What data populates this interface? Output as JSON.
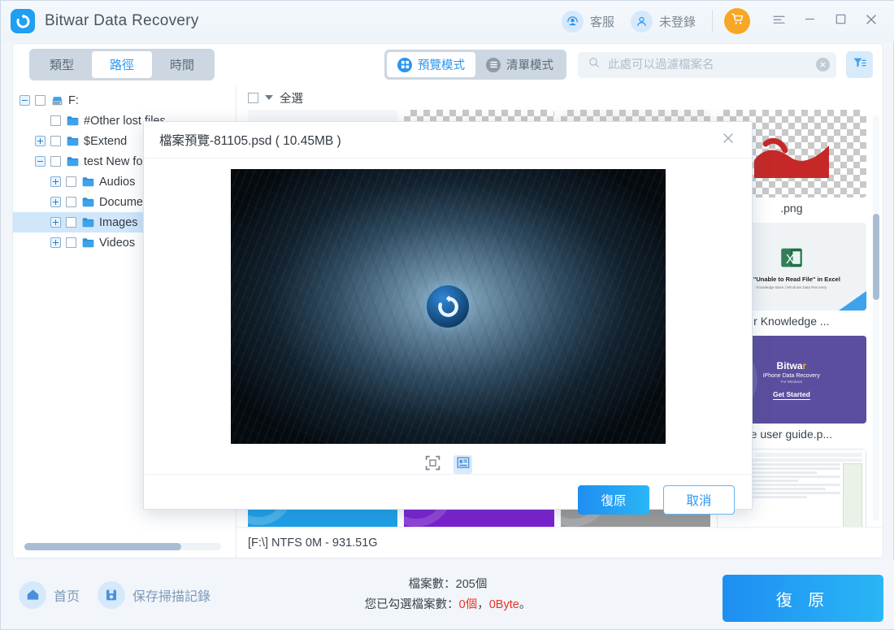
{
  "app": {
    "title": "Bitwar Data Recovery",
    "logo_icon": "bitwar-refresh-logo"
  },
  "titlebar": {
    "support_label": "客服",
    "support_icon": "headset-user-icon",
    "account_label": "未登錄",
    "account_icon": "user-icon",
    "cart_icon": "shopping-cart-icon",
    "menu_icon": "hamburger-menu-icon",
    "minimize_icon": "minimize-icon",
    "maximize_icon": "maximize-icon",
    "close_icon": "close-icon"
  },
  "toolbar": {
    "filters": [
      {
        "label": "類型",
        "active": false
      },
      {
        "label": "路徑",
        "active": true
      },
      {
        "label": "時間",
        "active": false
      }
    ],
    "view_modes": [
      {
        "label": "預覽模式",
        "icon": "grid-view-icon",
        "active": true
      },
      {
        "label": "清單模式",
        "icon": "list-view-icon",
        "active": false
      }
    ],
    "search": {
      "placeholder": "此處可以過濾檔案名",
      "value": "",
      "icon": "search-icon",
      "clear_icon": "clear-circle-icon"
    },
    "filter_icon": "funnel-filter-icon"
  },
  "tree": {
    "items": [
      {
        "label": "F:",
        "indent": 0,
        "expander": "minus",
        "icon": "drive-icon",
        "selected": false
      },
      {
        "label": "#Other lost files",
        "indent": 1,
        "expander": "none",
        "icon": "folder-icon",
        "selected": false
      },
      {
        "label": "$Extend",
        "indent": 1,
        "expander": "plus",
        "icon": "folder-icon",
        "selected": false
      },
      {
        "label": "test New folder",
        "indent": 1,
        "expander": "minus",
        "icon": "folder-icon",
        "selected": false
      },
      {
        "label": "Audios",
        "indent": 2,
        "expander": "plus",
        "icon": "folder-icon",
        "selected": false
      },
      {
        "label": "Documents",
        "indent": 2,
        "expander": "plus",
        "icon": "folder-icon",
        "selected": false
      },
      {
        "label": "Images",
        "indent": 2,
        "expander": "plus",
        "icon": "folder-icon",
        "selected": true
      },
      {
        "label": "Videos",
        "indent": 2,
        "expander": "plus",
        "icon": "folder-icon",
        "selected": false
      }
    ]
  },
  "files": {
    "select_all_label": "全選",
    "drive_info": "[F:\\] NTFS 0M - 931.51G",
    "items": [
      {
        "name": "",
        "thumb": "photo-yellow"
      },
      {
        "name": "",
        "thumb": "checker-green"
      },
      {
        "name": "",
        "thumb": "checker-sketch"
      },
      {
        "name": ".png",
        "thumb": "checker-red"
      },
      {
        "name": "",
        "thumb": "blank"
      },
      {
        "name": "",
        "thumb": "blank"
      },
      {
        "name": "",
        "thumb": "blank"
      },
      {
        "name": "r Knowledge ...",
        "thumb": "excel-article"
      },
      {
        "name": "",
        "thumb": "blank"
      },
      {
        "name": "",
        "thumb": "blank"
      },
      {
        "name": "",
        "thumb": "blank"
      },
      {
        "name": "e user guide.p...",
        "thumb": "bitwar-iphone"
      },
      {
        "name": "",
        "thumb": "latest-news"
      },
      {
        "name": "",
        "thumb": "text-scanner"
      },
      {
        "name": "",
        "thumb": "pdf-converter"
      },
      {
        "name": "",
        "thumb": "document-page"
      }
    ]
  },
  "modal": {
    "title": "檔案預覽-81105.psd ( 10.45MB )",
    "close_icon": "close-icon",
    "preview_logo_icon": "bitwar-refresh-logo",
    "tools": [
      {
        "icon": "fit-to-screen-icon",
        "active": false
      },
      {
        "icon": "image-details-icon",
        "active": true
      }
    ],
    "confirm_label": "復原",
    "cancel_label": "取消"
  },
  "statusbar": {
    "home_label": "首页",
    "home_icon": "home-icon",
    "save_label": "保存掃描記錄",
    "save_icon": "save-disk-icon",
    "file_count_label": "檔案數：205個",
    "selected_prefix": "您已勾選檔案數：",
    "selected_count": "0個",
    "selected_sep": "，",
    "selected_size": "0Byte",
    "selected_suffix": "。",
    "recover_label": "復 原"
  },
  "colors": {
    "accent": "#2b95ef",
    "accent_gradient_end": "#29b6f6",
    "cart_orange": "#f7a723",
    "red": "#e8332a",
    "panel_bg": "#f2f6fa"
  }
}
